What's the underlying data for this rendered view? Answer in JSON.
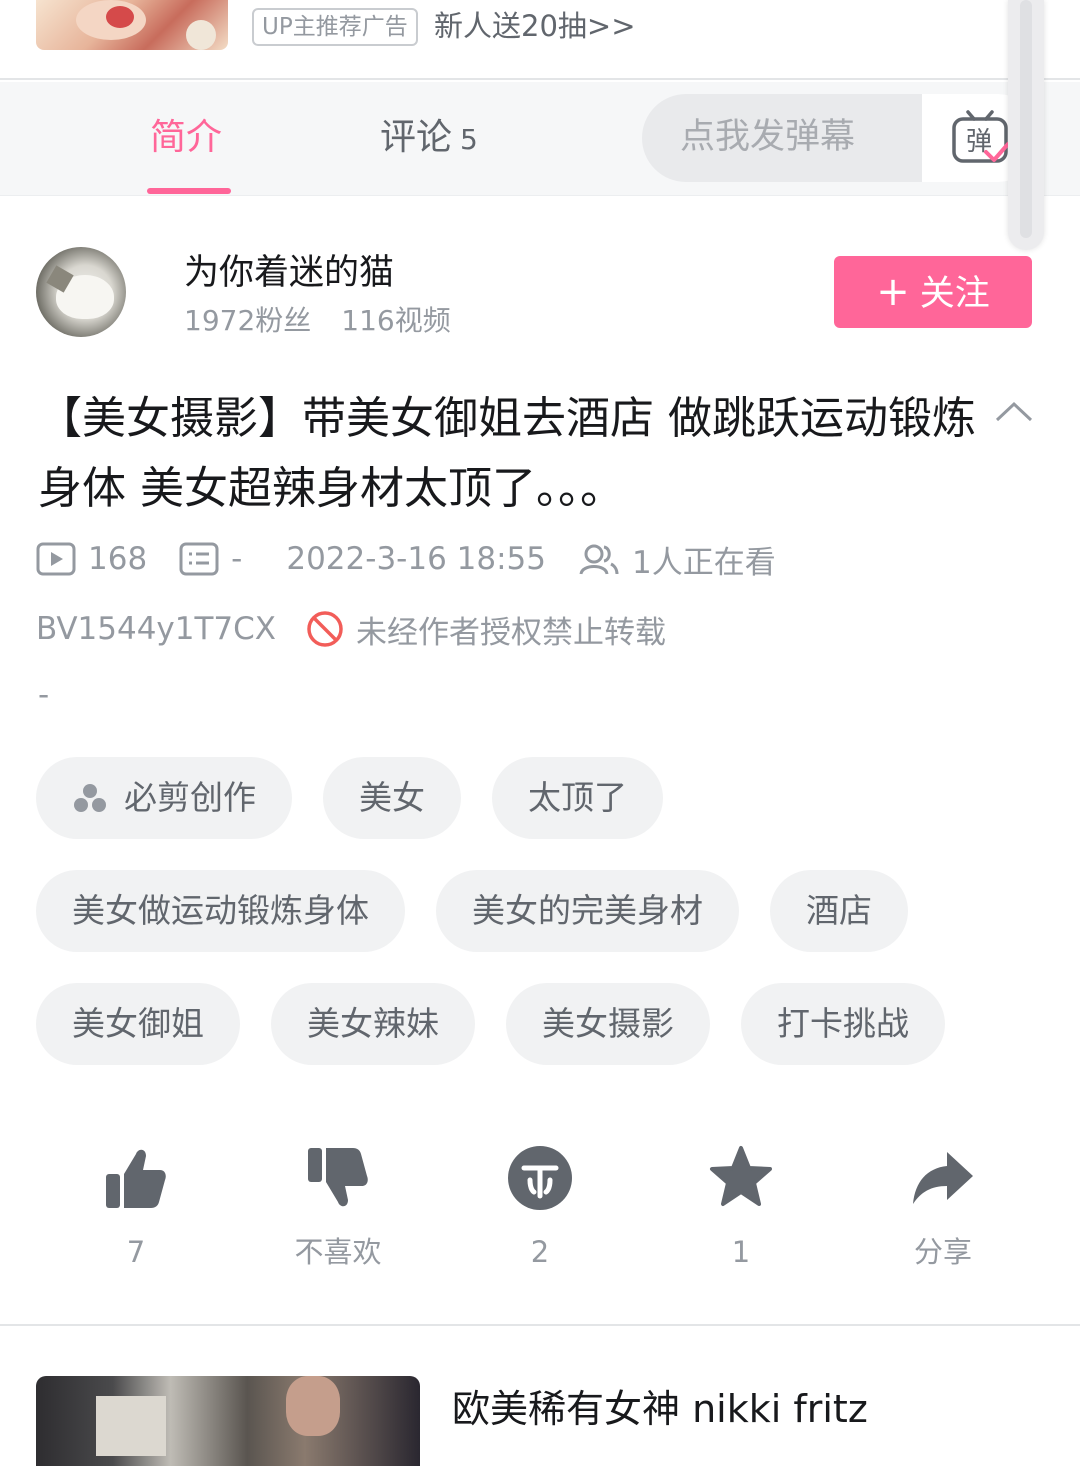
{
  "ad": {
    "badge": "UP主推荐广告",
    "text": "新人送20抽>>"
  },
  "tabs": {
    "intro": "简介",
    "comments": "评论",
    "comments_count": "5"
  },
  "danmaku": {
    "placeholder": "点我发弹幕",
    "icon_char": "弹"
  },
  "uploader": {
    "name": "为你着迷的猫",
    "fans": "1972粉丝",
    "videos": "116视频",
    "follow_label": "关注"
  },
  "video": {
    "title": "【美女摄影】带美女御姐去酒店 做跳跃运动锻炼身体 美女超辣身材太顶了。。。",
    "plays": "168",
    "danmaku_count": "-",
    "date": "2022-3-16 18:55",
    "watching": "1人正在看",
    "bvid": "BV1544y1T7CX",
    "copyright": "未经作者授权禁止转载",
    "description": "-"
  },
  "tags": [
    [
      "必剪创作",
      "美女",
      "太顶了"
    ],
    [
      "美女做运动锻炼身体",
      "美女的完美身材",
      "酒店"
    ],
    [
      "美女御姐",
      "美女辣妹",
      "美女摄影",
      "打卡挑战"
    ]
  ],
  "actions": {
    "like": "7",
    "dislike": "不喜欢",
    "coin": "2",
    "favorite": "1",
    "share": "分享"
  },
  "recommended": {
    "title": "欧美稀有女神 nikki fritz"
  },
  "colors": {
    "accent": "#ff6699",
    "text_primary": "#18191c",
    "text_secondary": "#9499a0",
    "tag_bg": "#f1f2f3",
    "icon_dark": "#61666d",
    "forbid_red": "#f25d59"
  }
}
